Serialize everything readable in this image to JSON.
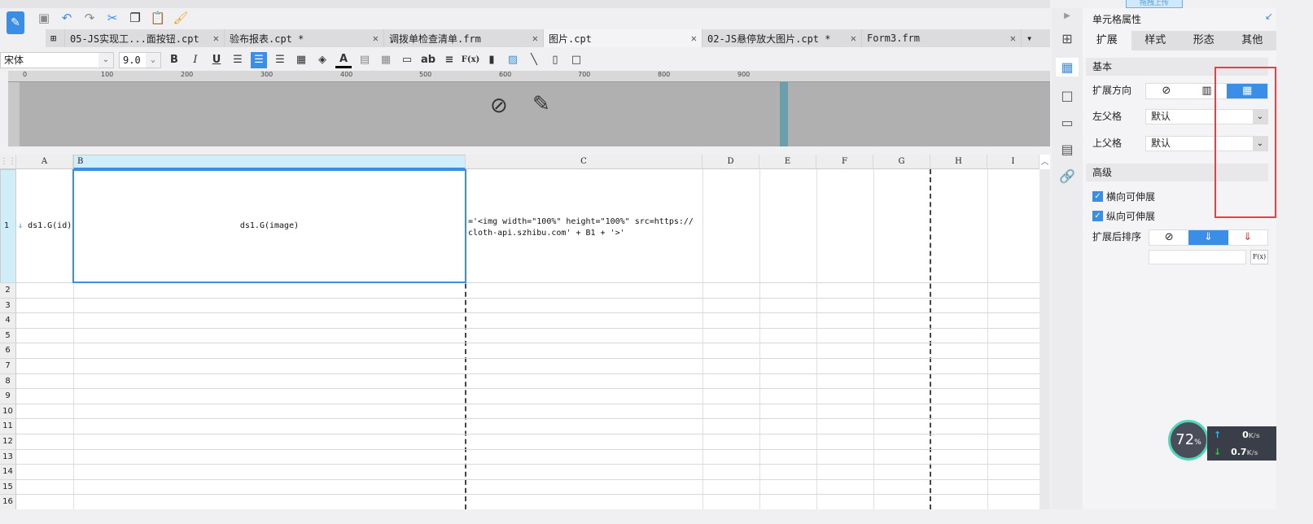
{
  "upload_label": "拖拽上传",
  "toolbar": {
    "icons": [
      "save-icon",
      "undo-icon",
      "redo-icon",
      "cut-icon",
      "copy-icon",
      "paste-icon",
      "format-painter-icon"
    ]
  },
  "tabs": [
    {
      "label": "05-JS实现工...面按钮.cpt"
    },
    {
      "label": "验布报表.cpt *"
    },
    {
      "label": "调拨单检查清单.frm"
    },
    {
      "label": "图片.cpt"
    },
    {
      "label": "02-JS悬停放大图片.cpt *"
    },
    {
      "label": "Form3.frm"
    }
  ],
  "format": {
    "font": "宋体",
    "size": "9.0",
    "bold": "B",
    "italic": "I",
    "underline": "U",
    "text_icon": "ab",
    "formula": "F(x)"
  },
  "ruler": [
    "0",
    "100",
    "200",
    "300",
    "400",
    "500",
    "600",
    "700",
    "800",
    "900"
  ],
  "columns": [
    "A",
    "B",
    "C",
    "D",
    "E",
    "F",
    "G",
    "H",
    "I"
  ],
  "rows": [
    "1",
    "2",
    "3",
    "4",
    "5",
    "6",
    "7",
    "8",
    "9",
    "10",
    "11",
    "12",
    "13",
    "14",
    "15",
    "16"
  ],
  "cells": {
    "a1": "ds1.G(id)",
    "b1": "ds1.G(image)",
    "c1_line1": "='<img width=\"100%\" height=\"100%\" src=https://",
    "c1_line2": "cloth-api.szhibu.com' + B1 + '>'"
  },
  "panel": {
    "title": "单元格属性",
    "tabs": [
      "扩展",
      "样式",
      "形态",
      "其他"
    ],
    "basic": "基本",
    "expand_dir": "扩展方向",
    "left_parent": "左父格",
    "left_parent_value": "默认",
    "top_parent": "上父格",
    "top_parent_value": "默认",
    "advanced": "高级",
    "h_expand": "横向可伸展",
    "v_expand": "纵向可伸展",
    "sort_after": "扩展后排序",
    "fx": "F(x)"
  },
  "monitor": {
    "percent": "72",
    "unit": "%",
    "up": "0",
    "down": "0.7",
    "speed_unit": "K/s"
  }
}
